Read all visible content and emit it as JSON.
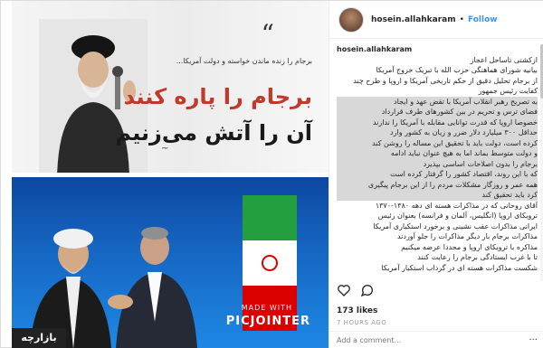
{
  "post": {
    "top_quote_mark": "“",
    "top_small_line": "برجام را زنده ماندن خواسته و دولت آمریکا...",
    "top_big_line1": "برجام را پاره کنند",
    "top_big_line2": "آن را آتش می‌زنیم",
    "made_with": "MADE WITH",
    "picjointer": "PICJOINTER",
    "watermark": "بازارچه"
  },
  "sidebar": {
    "username": "hosein.allahkaram",
    "follow_label": "Follow",
    "caption_user": "hosein.allahkaram",
    "caption_lines": [
      "ازکشتی تاساحل اعجاز",
      "بیانیه شورای هماهنگی حزب الله با تبریک خروج آمریکا",
      "از برجام تحلیل دقیق از حکم تاریخی آمریکا و اروپا و طرح چند",
      "کفایت رئیس جمهور",
      "به تصریح رهبر انقلاب آمریکا با تقض عهد و ایجاد",
      "فضای ترس و تحریم در بین کشورهای طرف قرارداد",
      "خصوصا اروپا که قدرت توانایی مقابله با آمریکا را ندارند",
      "حداقل ۳۰۰ میلیارد دلار ضرر و زیان به کشور وارد",
      "کرده است، دولت باید با تحقیق این مساله را روشن کند",
      "و دولت متوسط بماند اما به هیچ عنوان نباید ادامه",
      "برجام را بدون اصلاحات اساسی بپذیرد",
      "که با این روند، اقتصاد کشور را گرفتار کرده است",
      "همه عمر و روزگار مشکلات مردم را از این برجام پیگیری",
      "کرد باید تحقیق کند",
      "آقای روحانی که در مذاکرات هسته ای دهه ۱۳۸۰-۱۳۷۰",
      "ترویکای اروپا (انگلیس، آلمان و فرانسه) بعنوان رئیس",
      "ایرانی مذاکرات عقب نشینی و برخورد استکباری آمریکا",
      "مذاکرات برجام بار دیگر مذاکرات را جلو آوردند",
      "مذاکره با ترویکای اروپا و مجددا عرضه میکنیم",
      "تا با غرب ایستادگی برجام را رعایت کنند",
      "شکست مذاکرات هسته ای در گرداب استکبار آمریکا"
    ],
    "likes": "173 likes",
    "date": "7 HOURS AGO",
    "comment_placeholder": "Add a comment...",
    "more_label": "···"
  }
}
